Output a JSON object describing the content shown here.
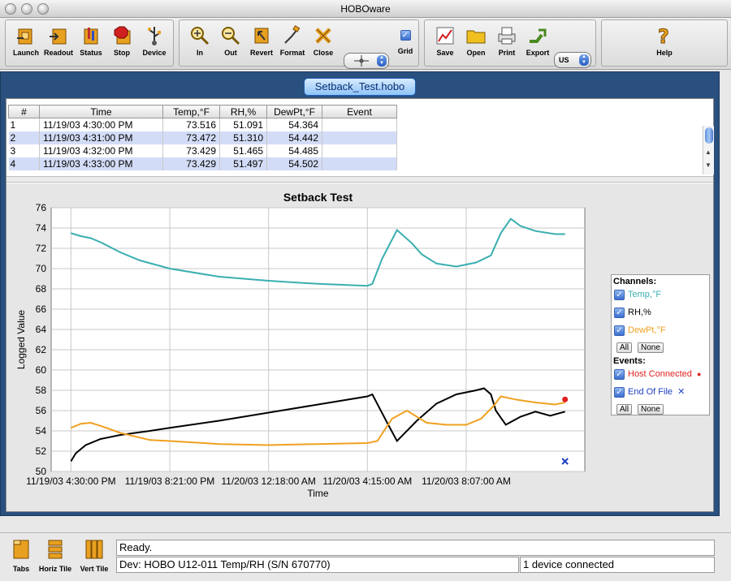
{
  "window": {
    "title": "HOBOware"
  },
  "toolbar": {
    "buttons": [
      {
        "label": "Launch"
      },
      {
        "label": "Readout"
      },
      {
        "label": "Status"
      },
      {
        "label": "Stop"
      },
      {
        "label": "Device"
      },
      {
        "label": "In"
      },
      {
        "label": "Out"
      },
      {
        "label": "Revert"
      },
      {
        "label": "Format"
      },
      {
        "label": "Close"
      },
      {
        "label": "Grid"
      },
      {
        "label": "Save"
      },
      {
        "label": "Open"
      },
      {
        "label": "Print"
      },
      {
        "label": "Export"
      },
      {
        "label": "Help"
      }
    ],
    "units_value": "US",
    "grid_checked": true
  },
  "document": {
    "tab_title": "Setback_Test.hobo",
    "table": {
      "columns": [
        "#",
        "Time",
        "Temp,°F",
        "RH,%",
        "DewPt,°F",
        "Event"
      ],
      "rows": [
        [
          "1",
          "11/19/03 4:30:00 PM",
          "73.516",
          "51.091",
          "54.364",
          ""
        ],
        [
          "2",
          "11/19/03 4:31:00 PM",
          "73.472",
          "51.310",
          "54.442",
          ""
        ],
        [
          "3",
          "11/19/03 4:32:00 PM",
          "73.429",
          "51.465",
          "54.485",
          ""
        ],
        [
          "4",
          "11/19/03 4:33:00 PM",
          "73.429",
          "51.497",
          "54.502",
          ""
        ]
      ]
    }
  },
  "chart_data": {
    "type": "line",
    "title": "Setback Test",
    "xlabel": "Time",
    "ylabel": "Logged Value",
    "ylim": [
      50,
      76
    ],
    "yticks": [
      50,
      52,
      54,
      56,
      58,
      60,
      62,
      64,
      66,
      68,
      70,
      72,
      74,
      76
    ],
    "xlim": [
      -0.2,
      5.2
    ],
    "xticks": [
      0,
      1,
      2,
      3,
      4
    ],
    "xtick_labels": [
      "11/19/03 4:30:00 PM",
      "11/19/03 8:21:00 PM",
      "11/20/03 12:18:00 AM",
      "11/20/03 4:15:00 AM",
      "11/20/03 8:07:00 AM"
    ],
    "grid": true,
    "legend": "right",
    "series": [
      {
        "name": "Temp,°F",
        "color": "#3aaeb0",
        "x": [
          0,
          0.1,
          0.2,
          0.3,
          0.5,
          0.7,
          1.0,
          1.5,
          2.0,
          2.5,
          3.0,
          3.05,
          3.15,
          3.3,
          3.45,
          3.55,
          3.7,
          3.9,
          4.1,
          4.25,
          4.35,
          4.45,
          4.55,
          4.7,
          4.9,
          5.0
        ],
        "y": [
          73.5,
          73.2,
          73.0,
          72.6,
          71.6,
          70.8,
          70.0,
          69.2,
          68.8,
          68.5,
          68.3,
          68.5,
          71.0,
          73.8,
          72.5,
          71.4,
          70.5,
          70.2,
          70.6,
          71.3,
          73.5,
          74.9,
          74.2,
          73.7,
          73.4,
          73.4
        ]
      },
      {
        "name": "RH,%",
        "color": "#000000",
        "x": [
          0,
          0.05,
          0.15,
          0.3,
          0.5,
          0.8,
          1.0,
          1.5,
          2.0,
          2.5,
          3.0,
          3.05,
          3.2,
          3.3,
          3.5,
          3.7,
          3.9,
          4.1,
          4.18,
          4.25,
          4.3,
          4.4,
          4.55,
          4.7,
          4.85,
          5.0
        ],
        "y": [
          51.0,
          51.8,
          52.6,
          53.2,
          53.6,
          54.0,
          54.3,
          55.0,
          55.8,
          56.6,
          57.4,
          57.6,
          54.8,
          53.0,
          55.0,
          56.7,
          57.6,
          58.0,
          58.2,
          57.6,
          56.0,
          54.6,
          55.4,
          55.9,
          55.5,
          55.9
        ]
      },
      {
        "name": "DewPt,°F",
        "color": "#f0a020",
        "x": [
          0,
          0.1,
          0.2,
          0.3,
          0.5,
          0.8,
          1.0,
          1.5,
          2.0,
          2.5,
          3.0,
          3.1,
          3.25,
          3.4,
          3.6,
          3.8,
          4.0,
          4.15,
          4.28,
          4.35,
          4.5,
          4.7,
          4.9,
          5.0
        ],
        "y": [
          54.3,
          54.7,
          54.8,
          54.5,
          53.8,
          53.1,
          53.0,
          52.7,
          52.6,
          52.7,
          52.8,
          53.0,
          55.2,
          56.0,
          54.8,
          54.6,
          54.6,
          55.2,
          56.5,
          57.4,
          57.1,
          56.8,
          56.6,
          56.8
        ]
      }
    ],
    "events": [
      {
        "name": "Host Connected",
        "color": "#e02020",
        "x": 5.0,
        "y": 57.1,
        "marker": "dot"
      },
      {
        "name": "End Of File",
        "color": "#2040c0",
        "x": 5.0,
        "y": 51.0,
        "marker": "x"
      }
    ]
  },
  "legend": {
    "channels_title": "Channels:",
    "events_title": "Events:",
    "channels": [
      {
        "label": "Temp,°F",
        "color": "#3aaeb0"
      },
      {
        "label": "RH,%",
        "color": "#000000"
      },
      {
        "label": "DewPt,°F",
        "color": "#f0a020"
      }
    ],
    "events": [
      {
        "label": "Host Connected",
        "color": "#e02020",
        "mark": "●"
      },
      {
        "label": "End Of File",
        "color": "#2040c0",
        "mark": "✕"
      }
    ],
    "all_label": "All",
    "none_label": "None"
  },
  "bottom": {
    "buttons": [
      {
        "label": "Tabs"
      },
      {
        "label": "Horiz Tile"
      },
      {
        "label": "Vert Tile"
      }
    ],
    "status_text": "Ready.",
    "device_text": "Dev: HOBO U12-011 Temp/RH (S/N 670770)",
    "connection_text": "1 device connected"
  }
}
